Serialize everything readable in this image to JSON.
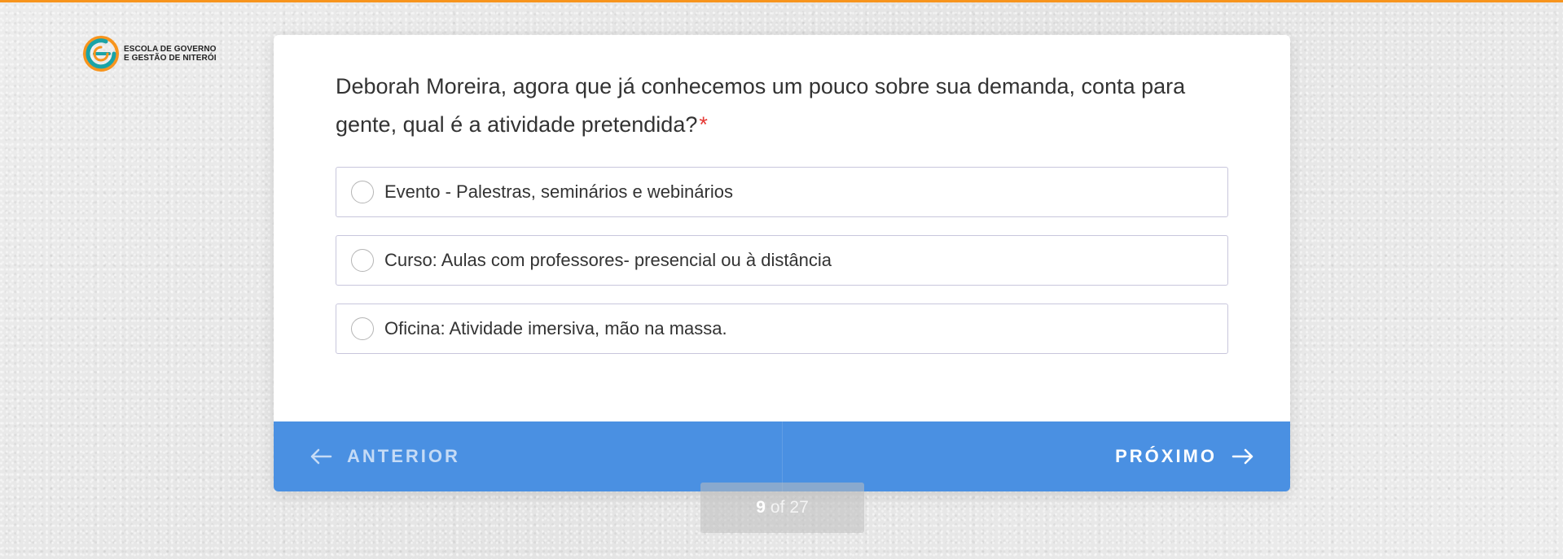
{
  "brand": {
    "logo_line1": "ESCOLA DE GOVERNO",
    "logo_line2": "E GESTÃO DE NITERÓI",
    "accent_color": "#f7941d",
    "teal_color": "#1aa3a6"
  },
  "question": {
    "text": "Deborah Moreira, agora que já conhecemos um pouco sobre sua demanda, conta para gente, qual é a atividade pretendida?",
    "required_mark": "*"
  },
  "options": [
    {
      "label": "Evento - Palestras, seminários e webinários",
      "selected": false
    },
    {
      "label": "Curso: Aulas com professores- presencial ou à distância",
      "selected": false
    },
    {
      "label": "Oficina: Atividade imersiva, mão na massa.",
      "selected": false
    }
  ],
  "navigation": {
    "prev_label": "ANTERIOR",
    "next_label": "PRÓXIMO",
    "bar_color": "#4a90e2",
    "prev_icon": "arrow-left-icon",
    "next_icon": "arrow-right-icon"
  },
  "progress": {
    "current": "9",
    "of_label": "of",
    "total": "27"
  }
}
